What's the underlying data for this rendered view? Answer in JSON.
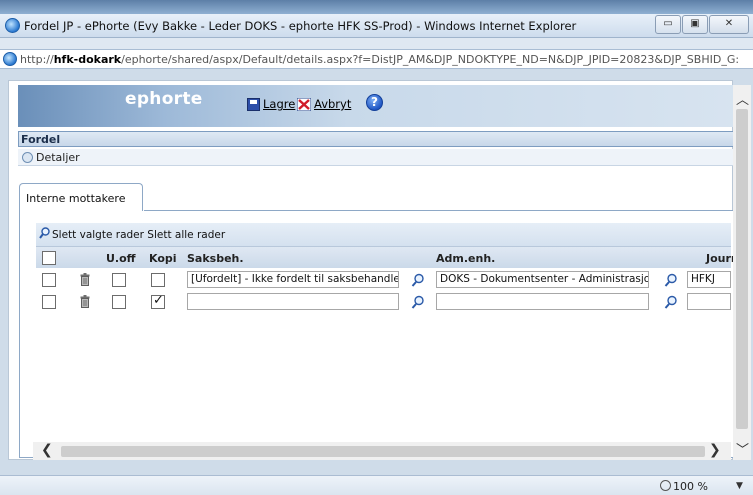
{
  "window": {
    "title": "Fordel JP - ePhorte (Evy Bakke - Leder DOKS - ephorte HFK SS-Prod) - Windows Internet Explorer",
    "minimize_glyph": "▭",
    "maximize_glyph": "▣",
    "close_glyph": "✕"
  },
  "address": {
    "url_prefix": "http://",
    "url_host": "hfk-dokark",
    "url_rest": "/ephorte/shared/aspx/Default/details.aspx?f=DistJP_AM&DJP_NDOKTYPE_ND=N&DJP_JPID=20823&DJP_SBHID_G:"
  },
  "app": {
    "logo": "ephorte",
    "toolbar": {
      "save_label": "Lagre",
      "cancel_label": "Avbryt",
      "help_glyph": "?"
    },
    "section_title": "Fordel",
    "details_label": "Detaljer"
  },
  "tabs": [
    {
      "label": "Interne mottakere",
      "active": true
    }
  ],
  "actions": {
    "delete_selected": "Slett valgte rader",
    "delete_all": "Slett alle rader"
  },
  "grid": {
    "columns": {
      "uoff": "U.off",
      "kopi": "Kopi",
      "saksbeh": "Saksbeh.",
      "admenh": "Adm.enh.",
      "journ": "Journ"
    },
    "rows": [
      {
        "selected": false,
        "uoff": false,
        "kopi": false,
        "saksbeh": "[Ufordelt] - Ikke fordelt til saksbehandler",
        "admenh": "DOKS - Dokumentsenter - Administrasjons",
        "journ": "HFKJ"
      },
      {
        "selected": false,
        "uoff": false,
        "kopi": true,
        "saksbeh": "",
        "admenh": "",
        "journ": ""
      }
    ]
  },
  "scroll": {
    "left_glyph": "❮",
    "right_glyph": "❯",
    "up_glyph": "︿",
    "down_glyph": "﹀"
  },
  "status": {
    "zoom": "100 %",
    "zoom_dropdown_glyph": "▼"
  },
  "colors": {
    "header_blue": "#6a8fb9",
    "grid_header": "#d4e1ef",
    "border_blue": "#8ea8c6"
  }
}
